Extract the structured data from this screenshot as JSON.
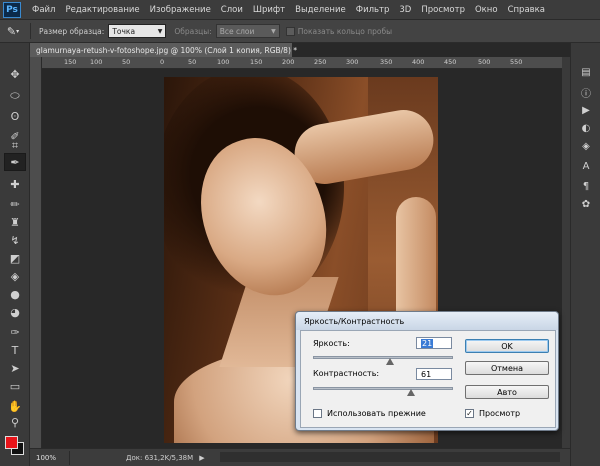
{
  "app": {
    "logo": "Ps"
  },
  "menubar": {
    "items": [
      "Файл",
      "Редактирование",
      "Изображение",
      "Слои",
      "Шрифт",
      "Выделение",
      "Фильтр",
      "3D",
      "Просмотр",
      "Окно",
      "Справка"
    ]
  },
  "options": {
    "sample_size_label": "Размер образца:",
    "sample_size_value": "Точка",
    "samples_label": "Образцы:",
    "samples_value": "Все слои",
    "show_ring_label": "Показать кольцо пробы"
  },
  "document": {
    "tab_title": "glamurnaya-retush-v-fotoshope.jpg @ 100% (Слой 1 копия, RGB/8) *",
    "ruler_ticks": [
      "150",
      "100",
      "50",
      "0",
      "50",
      "100",
      "150",
      "200",
      "250",
      "300",
      "350",
      "400",
      "450",
      "500",
      "550"
    ]
  },
  "status": {
    "zoom": "100%",
    "doc_info": "Док: 631,2K/5,38M",
    "arrow": "▶"
  },
  "colors": {
    "foreground": "#e8141a",
    "background": "#111111"
  },
  "dialog": {
    "title": "Яркость/Контрастность",
    "brightness_label": "Яркость:",
    "brightness_value": "21",
    "brightness_level": 0.55,
    "contrast_label": "Контрастность:",
    "contrast_value": "61",
    "contrast_level": 0.7,
    "use_legacy_label": "Использовать прежние",
    "use_legacy_checked": false,
    "preview_label": "Просмотр",
    "preview_checked": true,
    "ok_label": "OK",
    "cancel_label": "Отмена",
    "auto_label": "Авто"
  }
}
